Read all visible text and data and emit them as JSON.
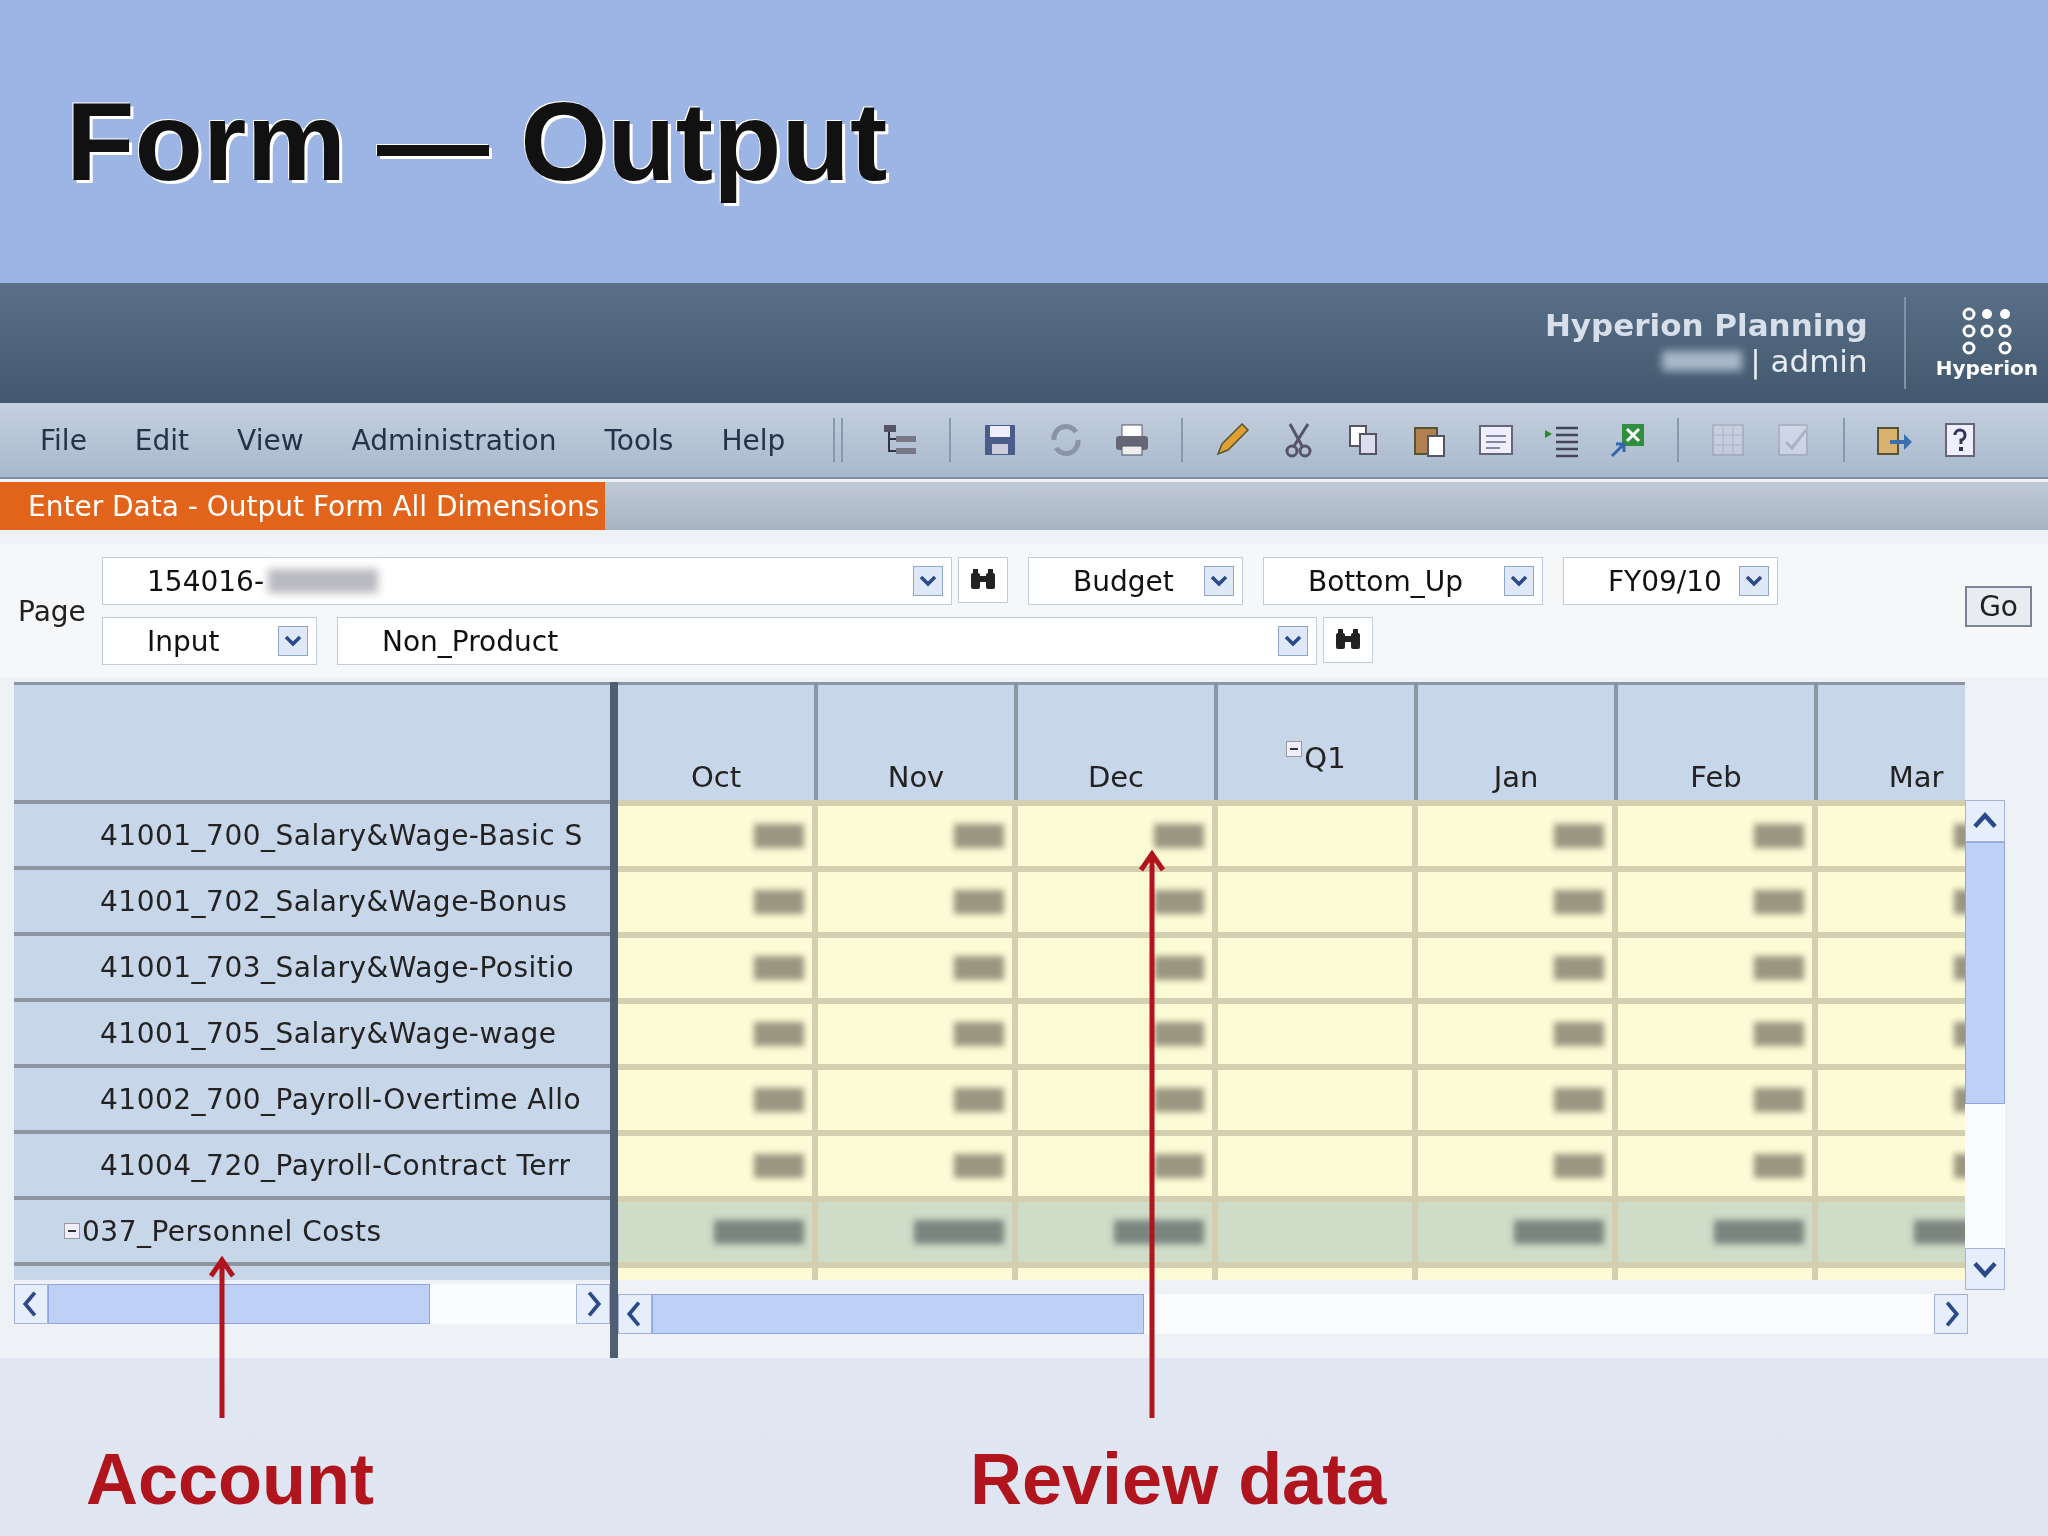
{
  "slide_title": "Form — Output",
  "header": {
    "product": "Hyperion Planning",
    "user": "| admin",
    "logo_text": "Hyperion"
  },
  "menu": [
    "File",
    "Edit",
    "View",
    "Administration",
    "Tools",
    "Help"
  ],
  "toolbar": [
    {
      "kind": "tree",
      "disabled": false
    },
    {
      "kind": "save",
      "disabled": false
    },
    {
      "kind": "refresh",
      "disabled": false
    },
    {
      "kind": "print",
      "disabled": false
    },
    {
      "kind": "pencil",
      "disabled": false
    },
    {
      "kind": "scissors",
      "disabled": false
    },
    {
      "kind": "copy",
      "disabled": false
    },
    {
      "kind": "paste",
      "disabled": false
    },
    {
      "kind": "spell",
      "disabled": false
    },
    {
      "kind": "list",
      "disabled": false
    },
    {
      "kind": "sheet",
      "disabled": false
    },
    {
      "kind": "grid",
      "disabled": true
    },
    {
      "kind": "note",
      "disabled": true
    },
    {
      "kind": "export",
      "disabled": false
    },
    {
      "kind": "help",
      "disabled": false
    }
  ],
  "tabs": [
    {
      "label": "Enter Data - Output Form All Dimensions",
      "selected": true
    }
  ],
  "page": {
    "label": "Page",
    "rows": [
      [
        {
          "value": "154016-",
          "kind": "entity",
          "search": true
        },
        {
          "value": "Budget",
          "kind": "short",
          "search": false
        },
        {
          "value": "Bottom_Up",
          "kind": "medium",
          "search": false
        },
        {
          "value": "FY09/10",
          "kind": "short",
          "search": false
        }
      ],
      [
        {
          "value": "Input",
          "kind": "short",
          "search": false
        },
        {
          "value": "Non_Product",
          "kind": "wide",
          "search": true
        }
      ]
    ],
    "go": "Go"
  },
  "grid": {
    "columns": [
      {
        "label": "Oct",
        "kind": "month"
      },
      {
        "label": "Nov",
        "kind": "month"
      },
      {
        "label": "Dec",
        "kind": "month"
      },
      {
        "label": "Q1",
        "kind": "quarter"
      },
      {
        "label": "Jan",
        "kind": "month"
      },
      {
        "label": "Feb",
        "kind": "month"
      },
      {
        "label": "Mar",
        "kind": "month"
      }
    ],
    "rows": [
      {
        "label": "41001_700_Salary&Wage-Basic S",
        "kind": "detail"
      },
      {
        "label": "41001_702_Salary&Wage-Bonus",
        "kind": "detail"
      },
      {
        "label": "41001_703_Salary&Wage-Positio",
        "kind": "detail"
      },
      {
        "label": "41001_705_Salary&Wage-wage",
        "kind": "detail"
      },
      {
        "label": "41002_700_Payroll-Overtime Allo",
        "kind": "detail"
      },
      {
        "label": "41004_720_Payroll-Contract Terr",
        "kind": "detail"
      },
      {
        "label": "037_Personnel Costs",
        "kind": "total"
      }
    ]
  },
  "annotations": [
    {
      "label": "Account"
    },
    {
      "label": "Review data"
    }
  ]
}
